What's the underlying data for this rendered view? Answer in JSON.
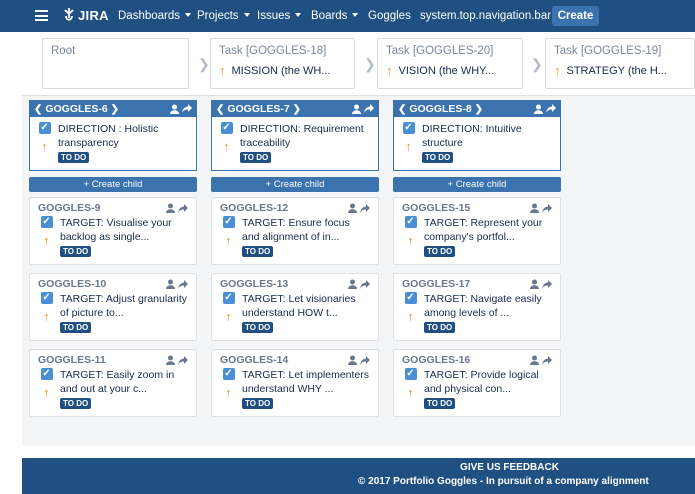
{
  "nav": {
    "logo": "JIRA",
    "items": [
      "Dashboards",
      "Projects",
      "Issues",
      "Boards",
      "Goggles",
      "system.top.navigation.bar"
    ],
    "create": "Create"
  },
  "breadcrumbs": [
    {
      "title": "Root",
      "sub": ""
    },
    {
      "title": "Task [GOGGLES-18]",
      "sub": "MISSION (the WH..."
    },
    {
      "title": "Task [GOGGLES-20]",
      "sub": "VISION (the WHY..."
    },
    {
      "title": "Task [GOGGLES-19]",
      "sub": "STRATEGY (the H..."
    }
  ],
  "columns": [
    {
      "key": "GOGGLES-6",
      "parent": {
        "text": "DIRECTION : Holistic transparency",
        "status": "TO DO"
      },
      "create_child": "+ Create child",
      "children": [
        {
          "key": "GOGGLES-9",
          "text": "TARGET: Visualise your backlog as single...",
          "status": "TO DO"
        },
        {
          "key": "GOGGLES-10",
          "text": "TARGET: Adjust granularity of picture to...",
          "status": "TO DO"
        },
        {
          "key": "GOGGLES-11",
          "text": "TARGET: Easily zoom in and out at your c...",
          "status": "TO DO"
        }
      ]
    },
    {
      "key": "GOGGLES-7",
      "parent": {
        "text": "DIRECTION: Requirement traceability",
        "status": "TO DO"
      },
      "create_child": "+ Create child",
      "children": [
        {
          "key": "GOGGLES-12",
          "text": "TARGET: Ensure focus and alignment of in...",
          "status": "TO DO"
        },
        {
          "key": "GOGGLES-13",
          "text": "TARGET: Let visionaries understand HOW t...",
          "status": "TO DO"
        },
        {
          "key": "GOGGLES-14",
          "text": "TARGET: Let implementers understand WHY ...",
          "status": "TO DO"
        }
      ]
    },
    {
      "key": "GOGGLES-8",
      "parent": {
        "text": "DIRECTION: Intuitive structure",
        "status": "TO DO"
      },
      "create_child": "+ Create child",
      "children": [
        {
          "key": "GOGGLES-15",
          "text": "TARGET: Represent your company's portfol...",
          "status": "TO DO"
        },
        {
          "key": "GOGGLES-17",
          "text": "TARGET: Navigate easily among levels of ...",
          "status": "TO DO"
        },
        {
          "key": "GOGGLES-16",
          "text": "TARGET: Provide logical and physical con...",
          "status": "TO DO"
        }
      ]
    }
  ],
  "footer": {
    "feedback": "GIVE US FEEDBACK",
    "copyright": "© 2017 Portfolio Goggles - In pursuit of a company alignment"
  },
  "colors": {
    "nav": "#205081",
    "accent": "#3b73af",
    "priority": "#f79232",
    "check": "#4a8fd6"
  },
  "icons": [
    "menu-icon",
    "jira-logo-icon",
    "user-icon",
    "share-arrow-icon",
    "checkbox-icon",
    "priority-up-icon",
    "chevron-left-icon",
    "chevron-right-icon"
  ]
}
